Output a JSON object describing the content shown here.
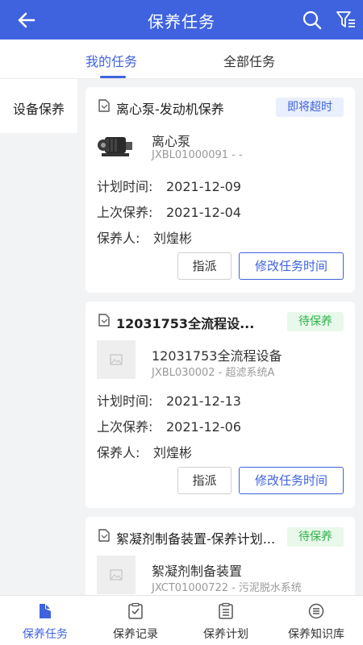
{
  "header": {
    "title": "保养任务",
    "color": "#3f63df"
  },
  "tabs": [
    {
      "label": "我的任务",
      "active": true
    },
    {
      "label": "全部任务",
      "active": false
    }
  ],
  "sidebar": {
    "items": [
      {
        "label": "设备保养",
        "active": true
      }
    ]
  },
  "cards": [
    {
      "title": "离心泵-发动机保养",
      "badge": "即将超时",
      "equipment_name": "离心泵",
      "code": "JXBL01000091 - -",
      "plan_label": "计划时间:",
      "plan_value": "2021-12-09",
      "last_label": "上次保养:",
      "last_value": "2021-12-04",
      "person_label": "保养人:",
      "person_value": "刘煌彬",
      "assign_label": "指派",
      "modify_label": "修改任务时间"
    },
    {
      "title": "12031753全流程设...",
      "badge": "待保养",
      "equipment_name": "12031753全流程设备",
      "code": "JXBL030002 - 超滤系统A",
      "plan_label": "计划时间:",
      "plan_value": "2021-12-13",
      "last_label": "上次保养:",
      "last_value": "2021-12-06",
      "person_label": "保养人:",
      "person_value": "刘煌彬",
      "assign_label": "指派",
      "modify_label": "修改任务时间"
    },
    {
      "title": "絮凝剂制备装置-保养计划...",
      "badge": "待保养",
      "equipment_name": "絮凝剂制备装置",
      "code": "JXCT01000722 - 污泥脱水系统"
    }
  ],
  "bottom_nav": [
    {
      "label": "保养任务",
      "icon": "task-icon",
      "active": true
    },
    {
      "label": "保养记录",
      "icon": "record-icon",
      "active": false
    },
    {
      "label": "保养计划",
      "icon": "plan-icon",
      "active": false
    },
    {
      "label": "保养知识库",
      "icon": "knowledge-icon",
      "active": false
    }
  ]
}
